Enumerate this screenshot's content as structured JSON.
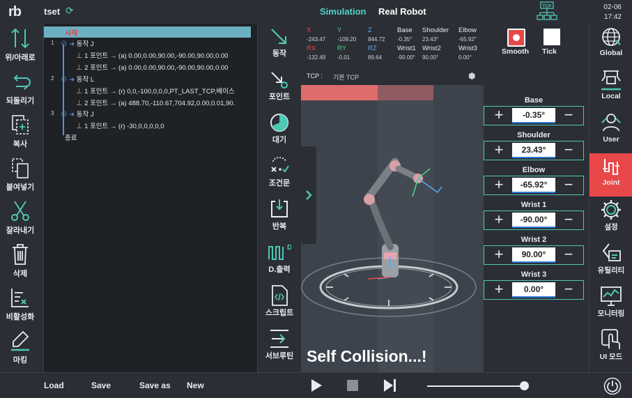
{
  "header": {
    "logo": "rb",
    "project_name": "tset",
    "tabs": [
      "Simulation",
      "Real Robot"
    ],
    "tcp_badge": "TCP",
    "date": "02-06",
    "time": "17:42"
  },
  "left_toolbar": [
    {
      "label": "위/아래로",
      "icon": "up-down-arrows-icon"
    },
    {
      "label": "되돌리기",
      "icon": "undo-icon"
    },
    {
      "label": "복사",
      "icon": "copy-icon"
    },
    {
      "label": "붙여넣기",
      "icon": "paste-icon"
    },
    {
      "label": "잘라내기",
      "icon": "scissors-icon"
    },
    {
      "label": "삭제",
      "icon": "trash-icon"
    },
    {
      "label": "비활성화",
      "icon": "disable-icon"
    },
    {
      "label": "마킹",
      "icon": "marker-icon"
    }
  ],
  "program": {
    "start": "시작",
    "lines": [
      {
        "num": "1",
        "text": "동작 J"
      },
      {
        "num": "",
        "text": "1 포인트 → (a) 0.00,0.00,90.00,-90.00,90.00,0.00"
      },
      {
        "num": "",
        "text": "2 포인트 → (a) 0.00,0.00,90.00,-90.00,90.00,0.00"
      },
      {
        "num": "2",
        "text": "동작 L"
      },
      {
        "num": "",
        "text": "1 포인트 → (r) 0,0,-100,0,0,0,PT_LAST_TCP,베이스"
      },
      {
        "num": "",
        "text": "2 포인트 → (a) 488.70,-110.67,704.92,0.00,0.01,90."
      },
      {
        "num": "3",
        "text": "동작 J"
      },
      {
        "num": "",
        "text": "1 포인트 → (r) -30,0,0,0,0,0"
      }
    ],
    "end": "종료"
  },
  "mid_toolbar": [
    {
      "label": "동작",
      "icon": "move-arrow-icon"
    },
    {
      "label": "포인트",
      "icon": "point-icon"
    },
    {
      "label": "대기",
      "icon": "wait-timer-icon"
    },
    {
      "label": "조건문",
      "icon": "condition-icon"
    },
    {
      "label": "반복",
      "icon": "repeat-icon"
    },
    {
      "label": "D.출력",
      "icon": "digital-output-icon"
    },
    {
      "label": "스크립트",
      "icon": "script-icon"
    },
    {
      "label": "서브루틴",
      "icon": "subroutine-icon"
    }
  ],
  "tcp_coords": {
    "X": "-243.47",
    "Y": "-109.20",
    "Z": "844.72",
    "RX": "-132.49",
    "RY": "-0.01",
    "RZ": "89.64"
  },
  "joint_readout": [
    {
      "name": "Base",
      "value": "-0.35°"
    },
    {
      "name": "Shoulder",
      "value": "23.43°"
    },
    {
      "name": "Elbow",
      "value": "-65.92°"
    },
    {
      "name": "Wrist1",
      "value": "-90.00°"
    },
    {
      "name": "Wrist2",
      "value": "90.00°"
    },
    {
      "name": "Wrist3",
      "value": "0.00°"
    }
  ],
  "view_options": {
    "smooth": "Smooth",
    "tick": "Tick"
  },
  "tcp_info": {
    "label": "TCP :",
    "value": "기본 TCP"
  },
  "collision_message": "Self Collision...!",
  "joint_controls": [
    {
      "name": "Base",
      "value": "-0.35°"
    },
    {
      "name": "Shoulder",
      "value": "23.43°"
    },
    {
      "name": "Elbow",
      "value": "-65.92°"
    },
    {
      "name": "Wrist 1",
      "value": "-90.00°"
    },
    {
      "name": "Wrist 2",
      "value": "90.00°"
    },
    {
      "name": "Wrist 3",
      "value": "0.00°"
    }
  ],
  "right_toolbar": [
    {
      "label": "Global",
      "icon": "globe-icon"
    },
    {
      "label": "Local",
      "icon": "local-frame-icon"
    },
    {
      "label": "User",
      "icon": "user-icon"
    },
    {
      "label": "Joint",
      "icon": "joint-icon"
    },
    {
      "label": "설정",
      "icon": "gear-icon"
    },
    {
      "label": "유틸리티",
      "icon": "utility-icon"
    },
    {
      "label": "모니터링",
      "icon": "monitor-icon"
    },
    {
      "label": "UI 모드",
      "icon": "touch-icon"
    }
  ],
  "footer": {
    "load": "Load",
    "save": "Save",
    "save_as": "Save as",
    "new": "New",
    "speed": 1.0
  },
  "colors": {
    "accent": "#4fc8b4",
    "active": "#e84848",
    "blue": "#5d8fdb"
  }
}
